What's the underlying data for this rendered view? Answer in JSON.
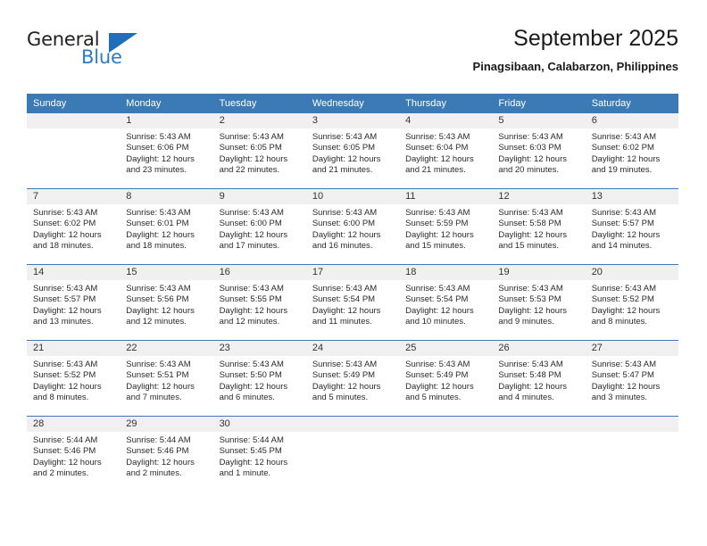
{
  "logo": {
    "text_top": "General",
    "text_bottom": "Blue",
    "triangle_color": "#1e6fb8",
    "blue_color": "#2b7cc2"
  },
  "header": {
    "title": "September 2025",
    "subtitle": "Pinagsibaan, Calabarzon, Philippines"
  },
  "theme": {
    "header_blue": "#3b7ab5",
    "daynum_band": "#f0f0f0"
  },
  "calendar": {
    "weekday_headers": [
      "Sunday",
      "Monday",
      "Tuesday",
      "Wednesday",
      "Thursday",
      "Friday",
      "Saturday"
    ],
    "weeks": [
      [
        {
          "day": "",
          "sunrise": "",
          "sunset": "",
          "daylight1": "",
          "daylight2": ""
        },
        {
          "day": "1",
          "sunrise": "Sunrise: 5:43 AM",
          "sunset": "Sunset: 6:06 PM",
          "daylight1": "Daylight: 12 hours",
          "daylight2": "and 23 minutes."
        },
        {
          "day": "2",
          "sunrise": "Sunrise: 5:43 AM",
          "sunset": "Sunset: 6:05 PM",
          "daylight1": "Daylight: 12 hours",
          "daylight2": "and 22 minutes."
        },
        {
          "day": "3",
          "sunrise": "Sunrise: 5:43 AM",
          "sunset": "Sunset: 6:05 PM",
          "daylight1": "Daylight: 12 hours",
          "daylight2": "and 21 minutes."
        },
        {
          "day": "4",
          "sunrise": "Sunrise: 5:43 AM",
          "sunset": "Sunset: 6:04 PM",
          "daylight1": "Daylight: 12 hours",
          "daylight2": "and 21 minutes."
        },
        {
          "day": "5",
          "sunrise": "Sunrise: 5:43 AM",
          "sunset": "Sunset: 6:03 PM",
          "daylight1": "Daylight: 12 hours",
          "daylight2": "and 20 minutes."
        },
        {
          "day": "6",
          "sunrise": "Sunrise: 5:43 AM",
          "sunset": "Sunset: 6:02 PM",
          "daylight1": "Daylight: 12 hours",
          "daylight2": "and 19 minutes."
        }
      ],
      [
        {
          "day": "7",
          "sunrise": "Sunrise: 5:43 AM",
          "sunset": "Sunset: 6:02 PM",
          "daylight1": "Daylight: 12 hours",
          "daylight2": "and 18 minutes."
        },
        {
          "day": "8",
          "sunrise": "Sunrise: 5:43 AM",
          "sunset": "Sunset: 6:01 PM",
          "daylight1": "Daylight: 12 hours",
          "daylight2": "and 18 minutes."
        },
        {
          "day": "9",
          "sunrise": "Sunrise: 5:43 AM",
          "sunset": "Sunset: 6:00 PM",
          "daylight1": "Daylight: 12 hours",
          "daylight2": "and 17 minutes."
        },
        {
          "day": "10",
          "sunrise": "Sunrise: 5:43 AM",
          "sunset": "Sunset: 6:00 PM",
          "daylight1": "Daylight: 12 hours",
          "daylight2": "and 16 minutes."
        },
        {
          "day": "11",
          "sunrise": "Sunrise: 5:43 AM",
          "sunset": "Sunset: 5:59 PM",
          "daylight1": "Daylight: 12 hours",
          "daylight2": "and 15 minutes."
        },
        {
          "day": "12",
          "sunrise": "Sunrise: 5:43 AM",
          "sunset": "Sunset: 5:58 PM",
          "daylight1": "Daylight: 12 hours",
          "daylight2": "and 15 minutes."
        },
        {
          "day": "13",
          "sunrise": "Sunrise: 5:43 AM",
          "sunset": "Sunset: 5:57 PM",
          "daylight1": "Daylight: 12 hours",
          "daylight2": "and 14 minutes."
        }
      ],
      [
        {
          "day": "14",
          "sunrise": "Sunrise: 5:43 AM",
          "sunset": "Sunset: 5:57 PM",
          "daylight1": "Daylight: 12 hours",
          "daylight2": "and 13 minutes."
        },
        {
          "day": "15",
          "sunrise": "Sunrise: 5:43 AM",
          "sunset": "Sunset: 5:56 PM",
          "daylight1": "Daylight: 12 hours",
          "daylight2": "and 12 minutes."
        },
        {
          "day": "16",
          "sunrise": "Sunrise: 5:43 AM",
          "sunset": "Sunset: 5:55 PM",
          "daylight1": "Daylight: 12 hours",
          "daylight2": "and 12 minutes."
        },
        {
          "day": "17",
          "sunrise": "Sunrise: 5:43 AM",
          "sunset": "Sunset: 5:54 PM",
          "daylight1": "Daylight: 12 hours",
          "daylight2": "and 11 minutes."
        },
        {
          "day": "18",
          "sunrise": "Sunrise: 5:43 AM",
          "sunset": "Sunset: 5:54 PM",
          "daylight1": "Daylight: 12 hours",
          "daylight2": "and 10 minutes."
        },
        {
          "day": "19",
          "sunrise": "Sunrise: 5:43 AM",
          "sunset": "Sunset: 5:53 PM",
          "daylight1": "Daylight: 12 hours",
          "daylight2": "and 9 minutes."
        },
        {
          "day": "20",
          "sunrise": "Sunrise: 5:43 AM",
          "sunset": "Sunset: 5:52 PM",
          "daylight1": "Daylight: 12 hours",
          "daylight2": "and 8 minutes."
        }
      ],
      [
        {
          "day": "21",
          "sunrise": "Sunrise: 5:43 AM",
          "sunset": "Sunset: 5:52 PM",
          "daylight1": "Daylight: 12 hours",
          "daylight2": "and 8 minutes."
        },
        {
          "day": "22",
          "sunrise": "Sunrise: 5:43 AM",
          "sunset": "Sunset: 5:51 PM",
          "daylight1": "Daylight: 12 hours",
          "daylight2": "and 7 minutes."
        },
        {
          "day": "23",
          "sunrise": "Sunrise: 5:43 AM",
          "sunset": "Sunset: 5:50 PM",
          "daylight1": "Daylight: 12 hours",
          "daylight2": "and 6 minutes."
        },
        {
          "day": "24",
          "sunrise": "Sunrise: 5:43 AM",
          "sunset": "Sunset: 5:49 PM",
          "daylight1": "Daylight: 12 hours",
          "daylight2": "and 5 minutes."
        },
        {
          "day": "25",
          "sunrise": "Sunrise: 5:43 AM",
          "sunset": "Sunset: 5:49 PM",
          "daylight1": "Daylight: 12 hours",
          "daylight2": "and 5 minutes."
        },
        {
          "day": "26",
          "sunrise": "Sunrise: 5:43 AM",
          "sunset": "Sunset: 5:48 PM",
          "daylight1": "Daylight: 12 hours",
          "daylight2": "and 4 minutes."
        },
        {
          "day": "27",
          "sunrise": "Sunrise: 5:43 AM",
          "sunset": "Sunset: 5:47 PM",
          "daylight1": "Daylight: 12 hours",
          "daylight2": "and 3 minutes."
        }
      ],
      [
        {
          "day": "28",
          "sunrise": "Sunrise: 5:44 AM",
          "sunset": "Sunset: 5:46 PM",
          "daylight1": "Daylight: 12 hours",
          "daylight2": "and 2 minutes."
        },
        {
          "day": "29",
          "sunrise": "Sunrise: 5:44 AM",
          "sunset": "Sunset: 5:46 PM",
          "daylight1": "Daylight: 12 hours",
          "daylight2": "and 2 minutes."
        },
        {
          "day": "30",
          "sunrise": "Sunrise: 5:44 AM",
          "sunset": "Sunset: 5:45 PM",
          "daylight1": "Daylight: 12 hours",
          "daylight2": "and 1 minute."
        },
        {
          "day": "",
          "sunrise": "",
          "sunset": "",
          "daylight1": "",
          "daylight2": ""
        },
        {
          "day": "",
          "sunrise": "",
          "sunset": "",
          "daylight1": "",
          "daylight2": ""
        },
        {
          "day": "",
          "sunrise": "",
          "sunset": "",
          "daylight1": "",
          "daylight2": ""
        },
        {
          "day": "",
          "sunrise": "",
          "sunset": "",
          "daylight1": "",
          "daylight2": ""
        }
      ]
    ]
  }
}
